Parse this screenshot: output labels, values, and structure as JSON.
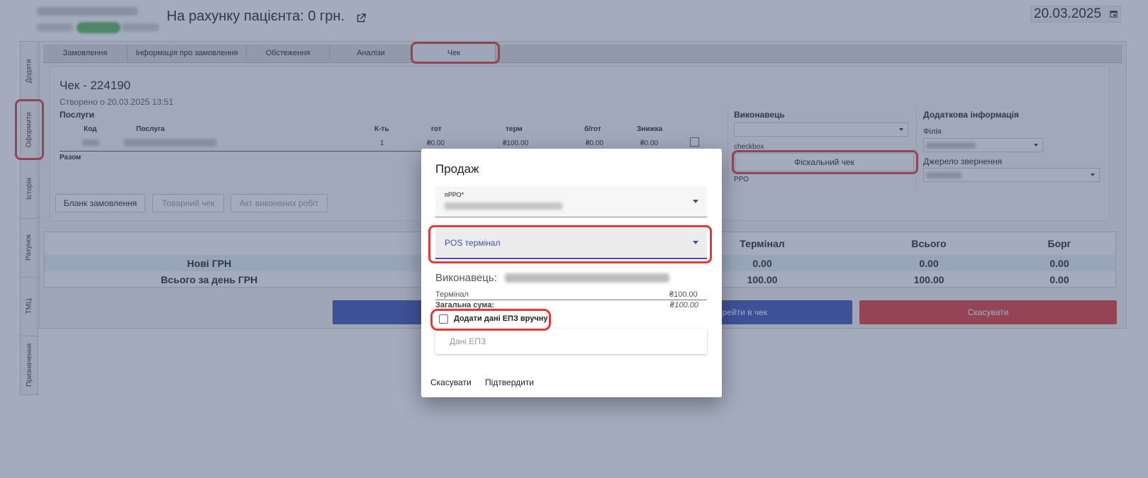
{
  "header": {
    "account_title": "На рахунку пацієнта: 0 грн.",
    "date": "20.03.2025"
  },
  "side_tabs": [
    {
      "label": "Додати"
    },
    {
      "label": "Оформити"
    },
    {
      "label": "Історія"
    },
    {
      "label": "Рахунок"
    },
    {
      "label": "ТМЦ"
    },
    {
      "label": "Призначення"
    }
  ],
  "top_tabs": [
    {
      "label": "Замовлення"
    },
    {
      "label": "Інформація про замовлення"
    },
    {
      "label": "Обстеження"
    },
    {
      "label": "Аналізи"
    },
    {
      "label": "Чек"
    }
  ],
  "receipt": {
    "title": "Чек - 224190",
    "created": "Створено о 20.03.2025 13:51",
    "services_title": "Послуги",
    "columns": [
      "Код",
      "Послуга",
      "К-ть",
      "гот",
      "терм",
      "б/гот",
      "Знижка"
    ],
    "row": {
      "qty": "1",
      "cash": "₴0.00",
      "term": "₴100.00",
      "noncash": "₴0.00",
      "discount": "₴0.00"
    },
    "total_label": "Разом",
    "buttons": {
      "order_form": "Бланк замовлення",
      "goods_receipt": "Товарний чек",
      "work_act": "Акт виконаних робіт"
    }
  },
  "executor_panel": {
    "title": "Виконавець",
    "checkbox_text": "checkbox",
    "fiscal_button": "Фіскальний чек",
    "rro_text": "РРО"
  },
  "extra_info": {
    "title": "Додаткова інформація",
    "branch_label": "Філія",
    "source_label": "Джерело звернення"
  },
  "summary": {
    "headers": [
      "Термінал",
      "Всього",
      "Борг"
    ],
    "rows": [
      {
        "label": "Нові ГРН",
        "terminal": "0.00",
        "total": "0.00",
        "debt": "0.00"
      },
      {
        "label": "Всього за день ГРН",
        "terminal": "100.00",
        "total": "100.00",
        "debt": "0.00"
      }
    ]
  },
  "actions": {
    "go_to_receipt": "перейти в чек",
    "cancel": "Скасувати"
  },
  "dialog": {
    "title": "Продаж",
    "prro_label": "пРРО*",
    "pos_label": "POS термінал",
    "executor_label": "Виконавець:",
    "terminal_label": "Термінал",
    "terminal_value": "₴100.00",
    "total_label": "Загальна сума:",
    "total_value": "₴100.00",
    "manual_epz_label": "Додати дані ЕПЗ вручну",
    "epz_placeholder": "Дані ЕПЗ",
    "cancel": "Скасувати",
    "confirm": "Підтвердити"
  },
  "colors": {
    "primary": "#3f51b5",
    "danger": "#e53935",
    "highlight": "#e53935",
    "status_green": "#5cb85c"
  }
}
